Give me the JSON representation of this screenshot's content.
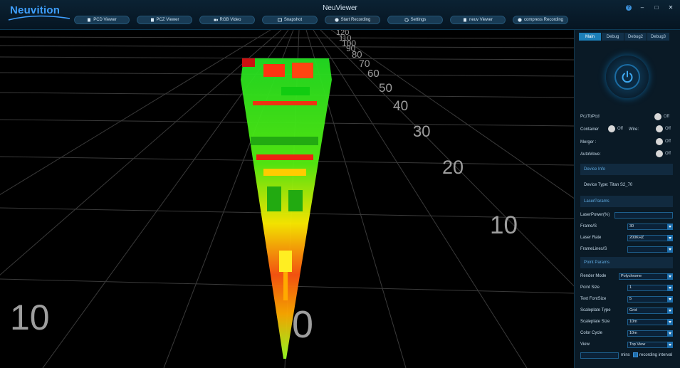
{
  "app": {
    "logo": "Neuvition",
    "title": "NeuViewer"
  },
  "toolbar": [
    {
      "label": "PCD Viewer",
      "icon": "file-icon"
    },
    {
      "label": "PCZ Viewer",
      "icon": "file-icon"
    },
    {
      "label": "RGB Video",
      "icon": "video-icon"
    },
    {
      "label": "Snapshot",
      "icon": "image-icon"
    },
    {
      "label": "Start Recording",
      "icon": "record-icon"
    },
    {
      "label": "Settings",
      "icon": "gear-icon"
    },
    {
      "label": "neuv Viewer",
      "icon": "file-icon"
    },
    {
      "label": "compress Recording",
      "icon": "compress-icon"
    }
  ],
  "viewer": {
    "far_scale": [
      "120",
      "110",
      "100",
      "90",
      "80",
      "70",
      "60",
      "50",
      "40",
      "30",
      "20",
      "10"
    ],
    "origin_label": "0",
    "left_label": "10"
  },
  "panel": {
    "tabs": [
      "Main",
      "Debug",
      "Debug2",
      "Debug3"
    ],
    "active_tab": "Main",
    "toggles": {
      "pcz_to_pcd": {
        "label": "PczToPcd",
        "state": "Off"
      },
      "container": {
        "label": "Container",
        "state": "Off"
      },
      "wire": {
        "label": "Wire:",
        "state": "Off"
      },
      "merger": {
        "label": "Merger :",
        "state": "Off"
      },
      "automove": {
        "label": "AutoMove:",
        "state": "Off"
      }
    },
    "device_info": {
      "header": "Device Info",
      "device_type": "Device Type: Titan S2_70"
    },
    "laser_params": {
      "header": "LaserParams",
      "laser_power_label": "LaserPower(%)",
      "laser_power_value": "",
      "frames_label": "Frame/S",
      "frames_value": "30",
      "laser_rate_label": "Laser Rate",
      "laser_rate_value": "200KHZ",
      "framelines_label": "FrameLines/S",
      "framelines_value": ""
    },
    "point_params": {
      "header": "Point Params",
      "render_mode_label": "Render Mode",
      "render_mode_value": "Polychrome",
      "point_size_label": "Point Size",
      "point_size_value": "1",
      "text_font_label": "Text FontSize",
      "text_font_value": "5",
      "scaleplate_type_label": "Scaleplate Type",
      "scaleplate_type_value": "Grid",
      "scaleplate_size_label": "Scaleplate Size",
      "scaleplate_size_value": "10m",
      "color_cycle_label": "Color Cycle",
      "color_cycle_value": "10m",
      "view_label": "View",
      "view_value": "Top View",
      "mins_value": "",
      "mins_label": "mins",
      "recording_interval_label": "recording interval"
    }
  },
  "colors": {
    "accent": "#1c7fb8",
    "panel_bg": "#0a1a26",
    "grid": "#3c3c3c"
  }
}
